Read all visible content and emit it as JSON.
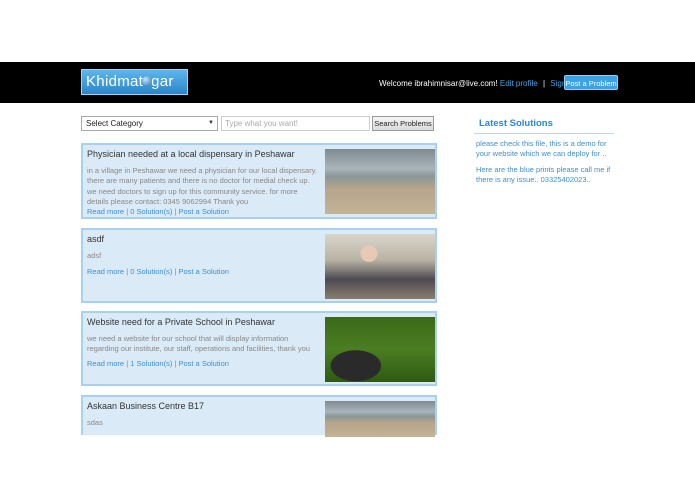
{
  "header": {
    "logo_left": "Khidmat",
    "logo_right": "gar",
    "welcome": "Welcome ibrahimnisar@live.com!",
    "edit_profile": "Edit profile",
    "separator": "|",
    "sign_out": "Sign out",
    "post_button": "Post a Problem"
  },
  "search": {
    "category": "Select Category",
    "placeholder": "Type what you want!",
    "button": "Search Problems"
  },
  "problems": [
    {
      "title": "Physician needed at a local dispensary in Peshawar",
      "description": "in a village in Peshawar we need a physician for our local dispensary. there are many patients and there is no doctor for medial check up. we need doctors to sign up for this community service. for more details please contact: 0345 9062994 Thank you",
      "read_more": "Read more",
      "solutions": "0 Solution(s)",
      "post_solution": "Post a Solution",
      "image": "school-building-photo"
    },
    {
      "title": "asdf",
      "description": "adsf",
      "read_more": "Read more",
      "solutions": "0 Solution(s)",
      "post_solution": "Post a Solution",
      "image": "baby-photo"
    },
    {
      "title": "Website need for a Private School in Peshawar",
      "description": "we need a website for our school that will display information regarding our institute, our staff, operations and facilities, thank you",
      "read_more": "Read more",
      "solutions": "1 Solution(s)",
      "post_solution": "Post a Solution",
      "image": "man-photo"
    },
    {
      "title": "Askaan Business Centre B17",
      "description": "sdas",
      "image": "school-building-photo"
    }
  ],
  "sidebar": {
    "title": "Latest Solutions",
    "solutions": [
      "please check this file, this is a demo for your website which we can deploy for ..",
      "Here are the blue prints please call me if there is any issue.. 03325402023.."
    ]
  },
  "colors": {
    "header_bg": "#000000",
    "accent": "#3aa2e6",
    "card_bg": "#daeaf7",
    "card_border": "#a8d1ef"
  }
}
